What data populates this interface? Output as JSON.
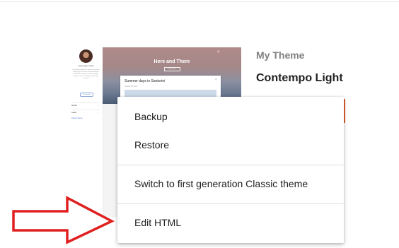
{
  "theme_preview": {
    "author": "Lorem ipsum name",
    "bio": "Lorem ipsum dolor sit amet consectetur adipiscing elit sed do eiusmod tempor incididunt ut labore et dolore magna aliqua ut enim ad minim veniam quis nostrud",
    "visit_label": "Visit profile",
    "menu_items": [
      "Archive",
      "Labels"
    ],
    "report_label": "Report Abuse",
    "blog_title": "Here and There",
    "hero_button": "Subscribe",
    "post_title": "Summer days in Santorini",
    "post_date": "October 18, 2017"
  },
  "theme_info": {
    "section_title": "My Theme",
    "theme_name": "Contempo Light"
  },
  "menu": {
    "items": [
      {
        "label": "Backup"
      },
      {
        "label": "Restore"
      },
      {
        "label": "Switch to first generation Classic theme"
      },
      {
        "label": "Edit HTML"
      }
    ]
  },
  "colors": {
    "arrow": "#e02020",
    "accent": "#e4632d"
  }
}
